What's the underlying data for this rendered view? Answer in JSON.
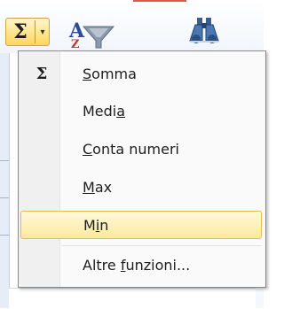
{
  "toolbar": {
    "autosum_symbol": "Σ",
    "autosum_arrow": "▾",
    "sort_icon": "sort-filter-icon",
    "find_icon": "find-select-icon",
    "autosum_colors": {
      "fill_top": "#fff6cc",
      "fill_bottom": "#ffd65a",
      "border": "#d0a544"
    }
  },
  "menu": {
    "gutter_icon": "Σ",
    "items": [
      {
        "pre": "",
        "u": "S",
        "post": "omma"
      },
      {
        "pre": "Medi",
        "u": "a",
        "post": ""
      },
      {
        "pre": "",
        "u": "C",
        "post": "onta numeri"
      },
      {
        "pre": "",
        "u": "M",
        "post": "ax"
      },
      {
        "pre": "M",
        "u": "i",
        "post": "n"
      },
      {
        "pre": "Altre ",
        "u": "f",
        "post": "unzioni..."
      }
    ],
    "highlighted_index": 4,
    "highlight_colors": {
      "fill_top": "#fff9dd",
      "fill_bottom": "#fde99b",
      "border": "#e3bb55"
    }
  }
}
